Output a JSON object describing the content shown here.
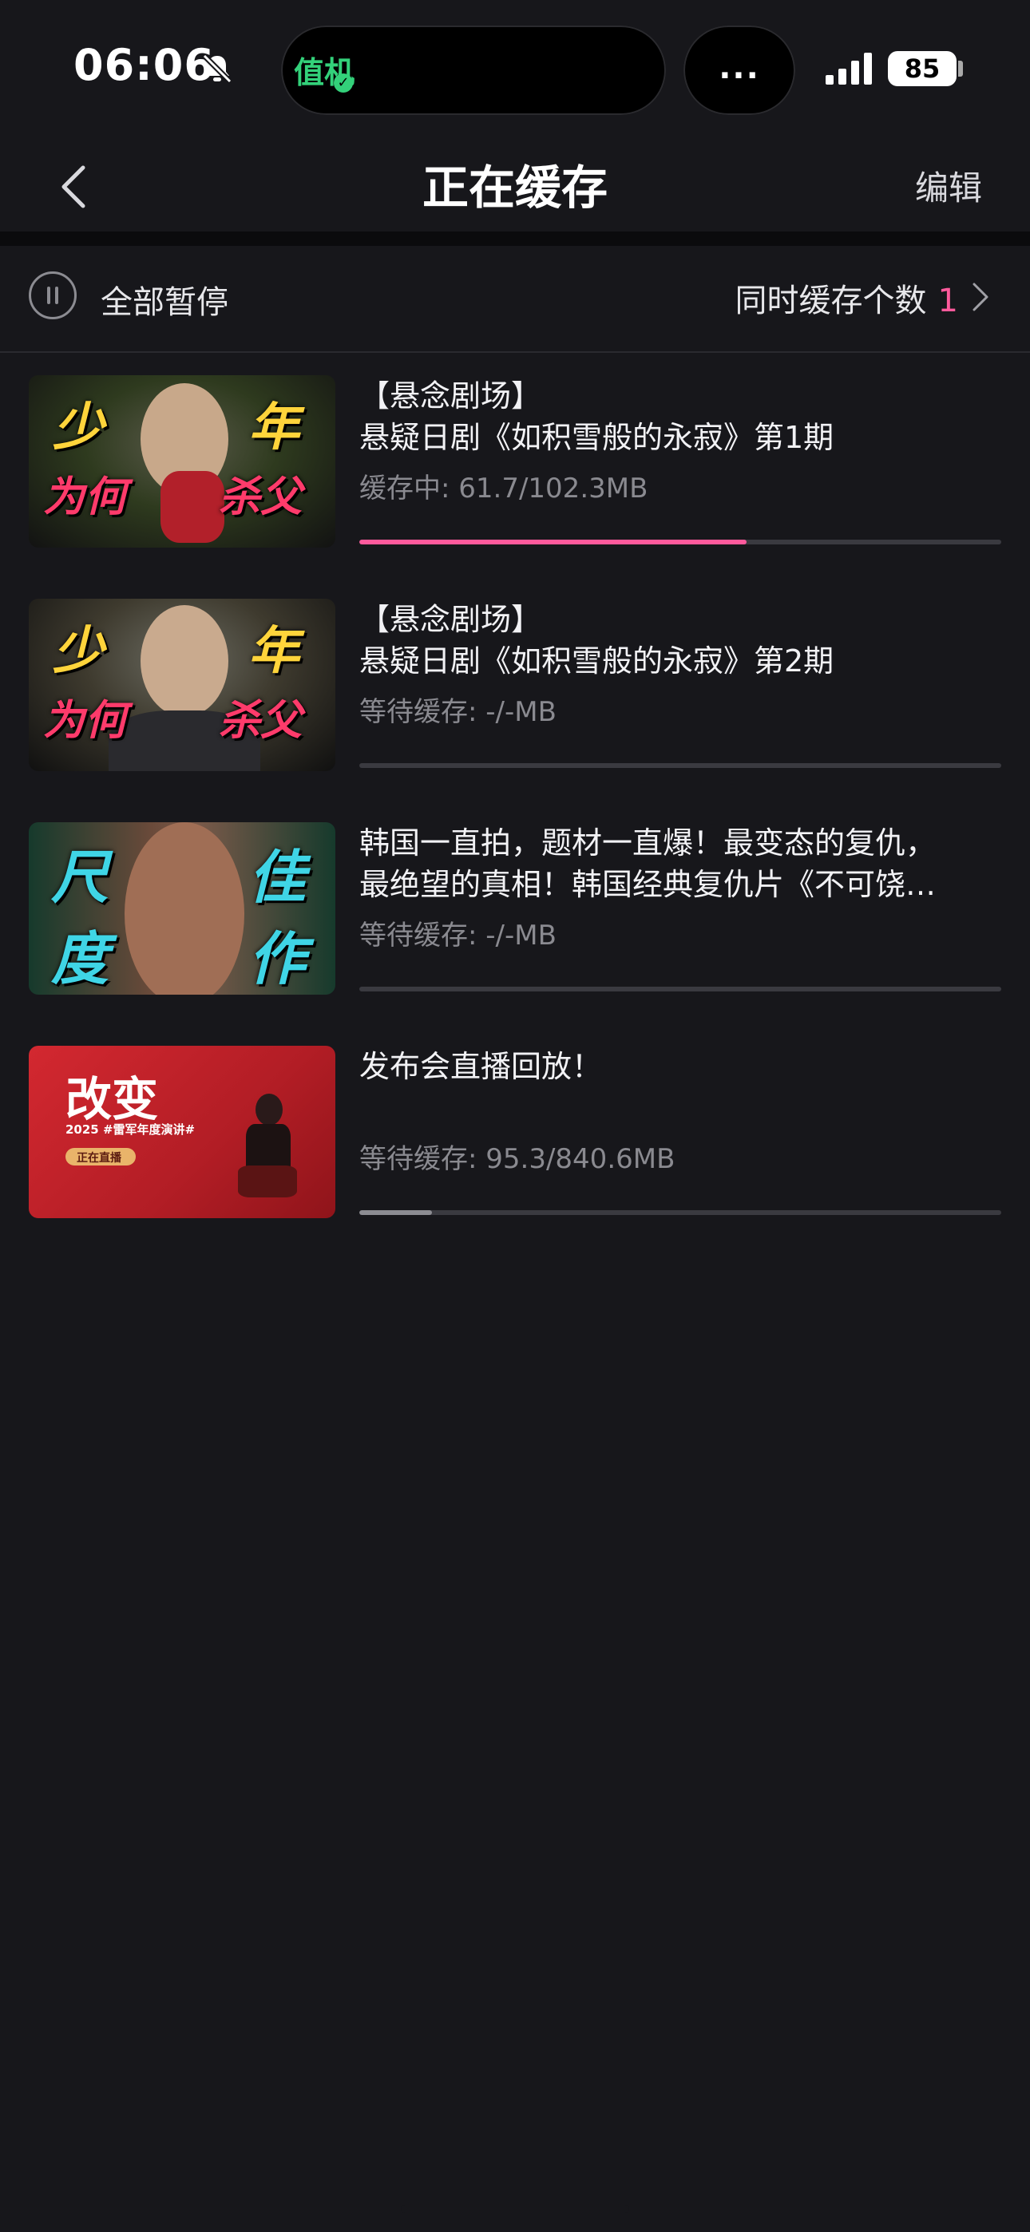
{
  "status_bar": {
    "time": "06:06",
    "island_app": "值机",
    "island_more": "...",
    "battery": "85"
  },
  "header": {
    "title": "正在缓存",
    "edit": "编辑"
  },
  "controls": {
    "pause_all": "全部暂停",
    "concurrency_label": "同时缓存个数",
    "concurrency_value": "1"
  },
  "items": [
    {
      "title": "【悬念剧场】\n悬疑日剧《如积雪般的永寂》第1期",
      "status": "缓存中: 61.7/102.3MB",
      "progress": 0.603,
      "thumb_text": [
        "少",
        "年",
        "为何",
        "杀父"
      ]
    },
    {
      "title": "【悬念剧场】\n悬疑日剧《如积雪般的永寂》第2期",
      "status": "等待缓存: -/-MB",
      "progress": 0,
      "thumb_text": [
        "少",
        "年",
        "为何",
        "杀父"
      ]
    },
    {
      "title": "韩国一直拍，题材一直爆！最变态的复仇，\n最绝望的真相！韩国经典复仇片《不可饶…",
      "status": "等待缓存: -/-MB",
      "progress": 0,
      "thumb_text": [
        "尺",
        "佳",
        "度",
        "作"
      ]
    },
    {
      "title": "发布会直播回放！",
      "status": "等待缓存: 95.3/840.6MB",
      "progress": 0.113,
      "thumb_text": [
        "改变",
        "2025 #雷军年度演讲#",
        "正在直播"
      ]
    }
  ],
  "colors": {
    "accent": "#ff5a9c",
    "background": "#17171b"
  }
}
